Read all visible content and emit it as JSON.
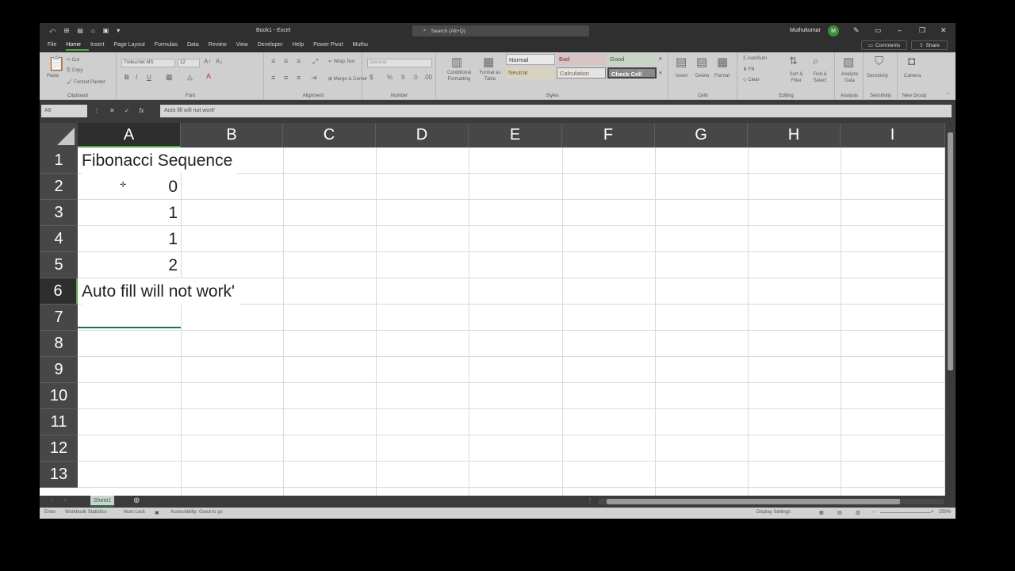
{
  "window": {
    "title": "Book1 - Excel",
    "search_placeholder": "Search (Alt+Q)",
    "user_name": "Muthukumar",
    "user_initial": "M"
  },
  "ribbon_tabs": [
    "File",
    "Home",
    "Insert",
    "Page Layout",
    "Formulas",
    "Data",
    "Review",
    "View",
    "Developer",
    "Help",
    "Power Pivot",
    "Muthu"
  ],
  "ribbon_actions": {
    "comments": "Comments",
    "share": "Share"
  },
  "ribbon": {
    "clipboard": {
      "paste": "Paste",
      "cut": "Cut",
      "copy": "Copy",
      "format_painter": "Format Painter",
      "label": "Clipboard"
    },
    "font": {
      "font_name": "Trebuchet MS",
      "font_size": "12",
      "label": "Font"
    },
    "alignment": {
      "wrap_text": "Wrap Text",
      "merge_center": "Merge & Center",
      "label": "Alignment"
    },
    "number": {
      "format": "General",
      "label": "Number"
    },
    "styles": {
      "conditional": "Conditional Formatting",
      "format_as_table": "Format as Table",
      "normal": "Normal",
      "bad": "Bad",
      "good": "Good",
      "neutral": "Neutral",
      "calculation": "Calculation",
      "check_cell": "Check Cell",
      "label": "Styles"
    },
    "cells": {
      "insert": "Insert",
      "delete": "Delete",
      "format": "Format",
      "label": "Cells"
    },
    "editing": {
      "autosum": "AutoSum",
      "fill": "Fill",
      "clear": "Clear",
      "sort_filter": "Sort & Filter",
      "find_select": "Find & Select",
      "label": "Editing"
    },
    "analysis": {
      "analyze_data": "Analyze Data",
      "label": "Analysis"
    },
    "sensitivity": {
      "button": "Sensitivity",
      "label": "Sensitivity"
    },
    "new_group": {
      "camera": "Camera",
      "label": "New Group"
    }
  },
  "formula_bar": {
    "name_box": "A6",
    "content": "Auto fill will not work'"
  },
  "columns": [
    "A",
    "B",
    "C",
    "D",
    "E",
    "F",
    "G",
    "H",
    "I"
  ],
  "rows": [
    "1",
    "2",
    "3",
    "4",
    "5",
    "6",
    "7",
    "8",
    "9",
    "10",
    "11",
    "12",
    "13"
  ],
  "cells": {
    "A1": "Fibonacci Sequence",
    "A2": "0",
    "A3": "1",
    "A4": "1",
    "A5": "2",
    "A6": "Auto fill will not work'"
  },
  "selected_cell": "A6",
  "sheet_tabs": [
    "Sheet1"
  ],
  "status_bar": {
    "mode": "Enter",
    "workbook_statistics": "Workbook Statistics",
    "num_lock": "Num Lock",
    "accessibility": "Accessibility: Good to go",
    "display_settings": "Display Settings",
    "zoom": "250%"
  }
}
